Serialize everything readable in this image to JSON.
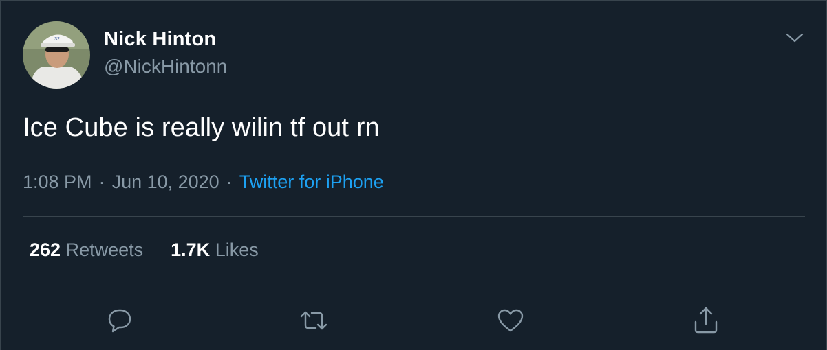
{
  "user": {
    "name": "Nick Hinton",
    "handle": "@NickHintonn"
  },
  "tweet": {
    "text": "Ice Cube is really wilin tf out rn",
    "time": "1:08 PM",
    "separator": "·",
    "date": "Jun 10, 2020",
    "source": "Twitter for iPhone"
  },
  "stats": {
    "retweets_count": "262",
    "retweets_label": "Retweets",
    "likes_count": "1.7K",
    "likes_label": "Likes"
  },
  "icons": {
    "menu": "chevron-down-icon",
    "reply": "reply-icon",
    "retweet": "retweet-icon",
    "like": "heart-icon",
    "share": "share-icon"
  },
  "colors": {
    "background": "#15202b",
    "divider": "#38444d",
    "primary_text": "#ffffff",
    "secondary_text": "#8899a6",
    "accent": "#1da1f2"
  }
}
